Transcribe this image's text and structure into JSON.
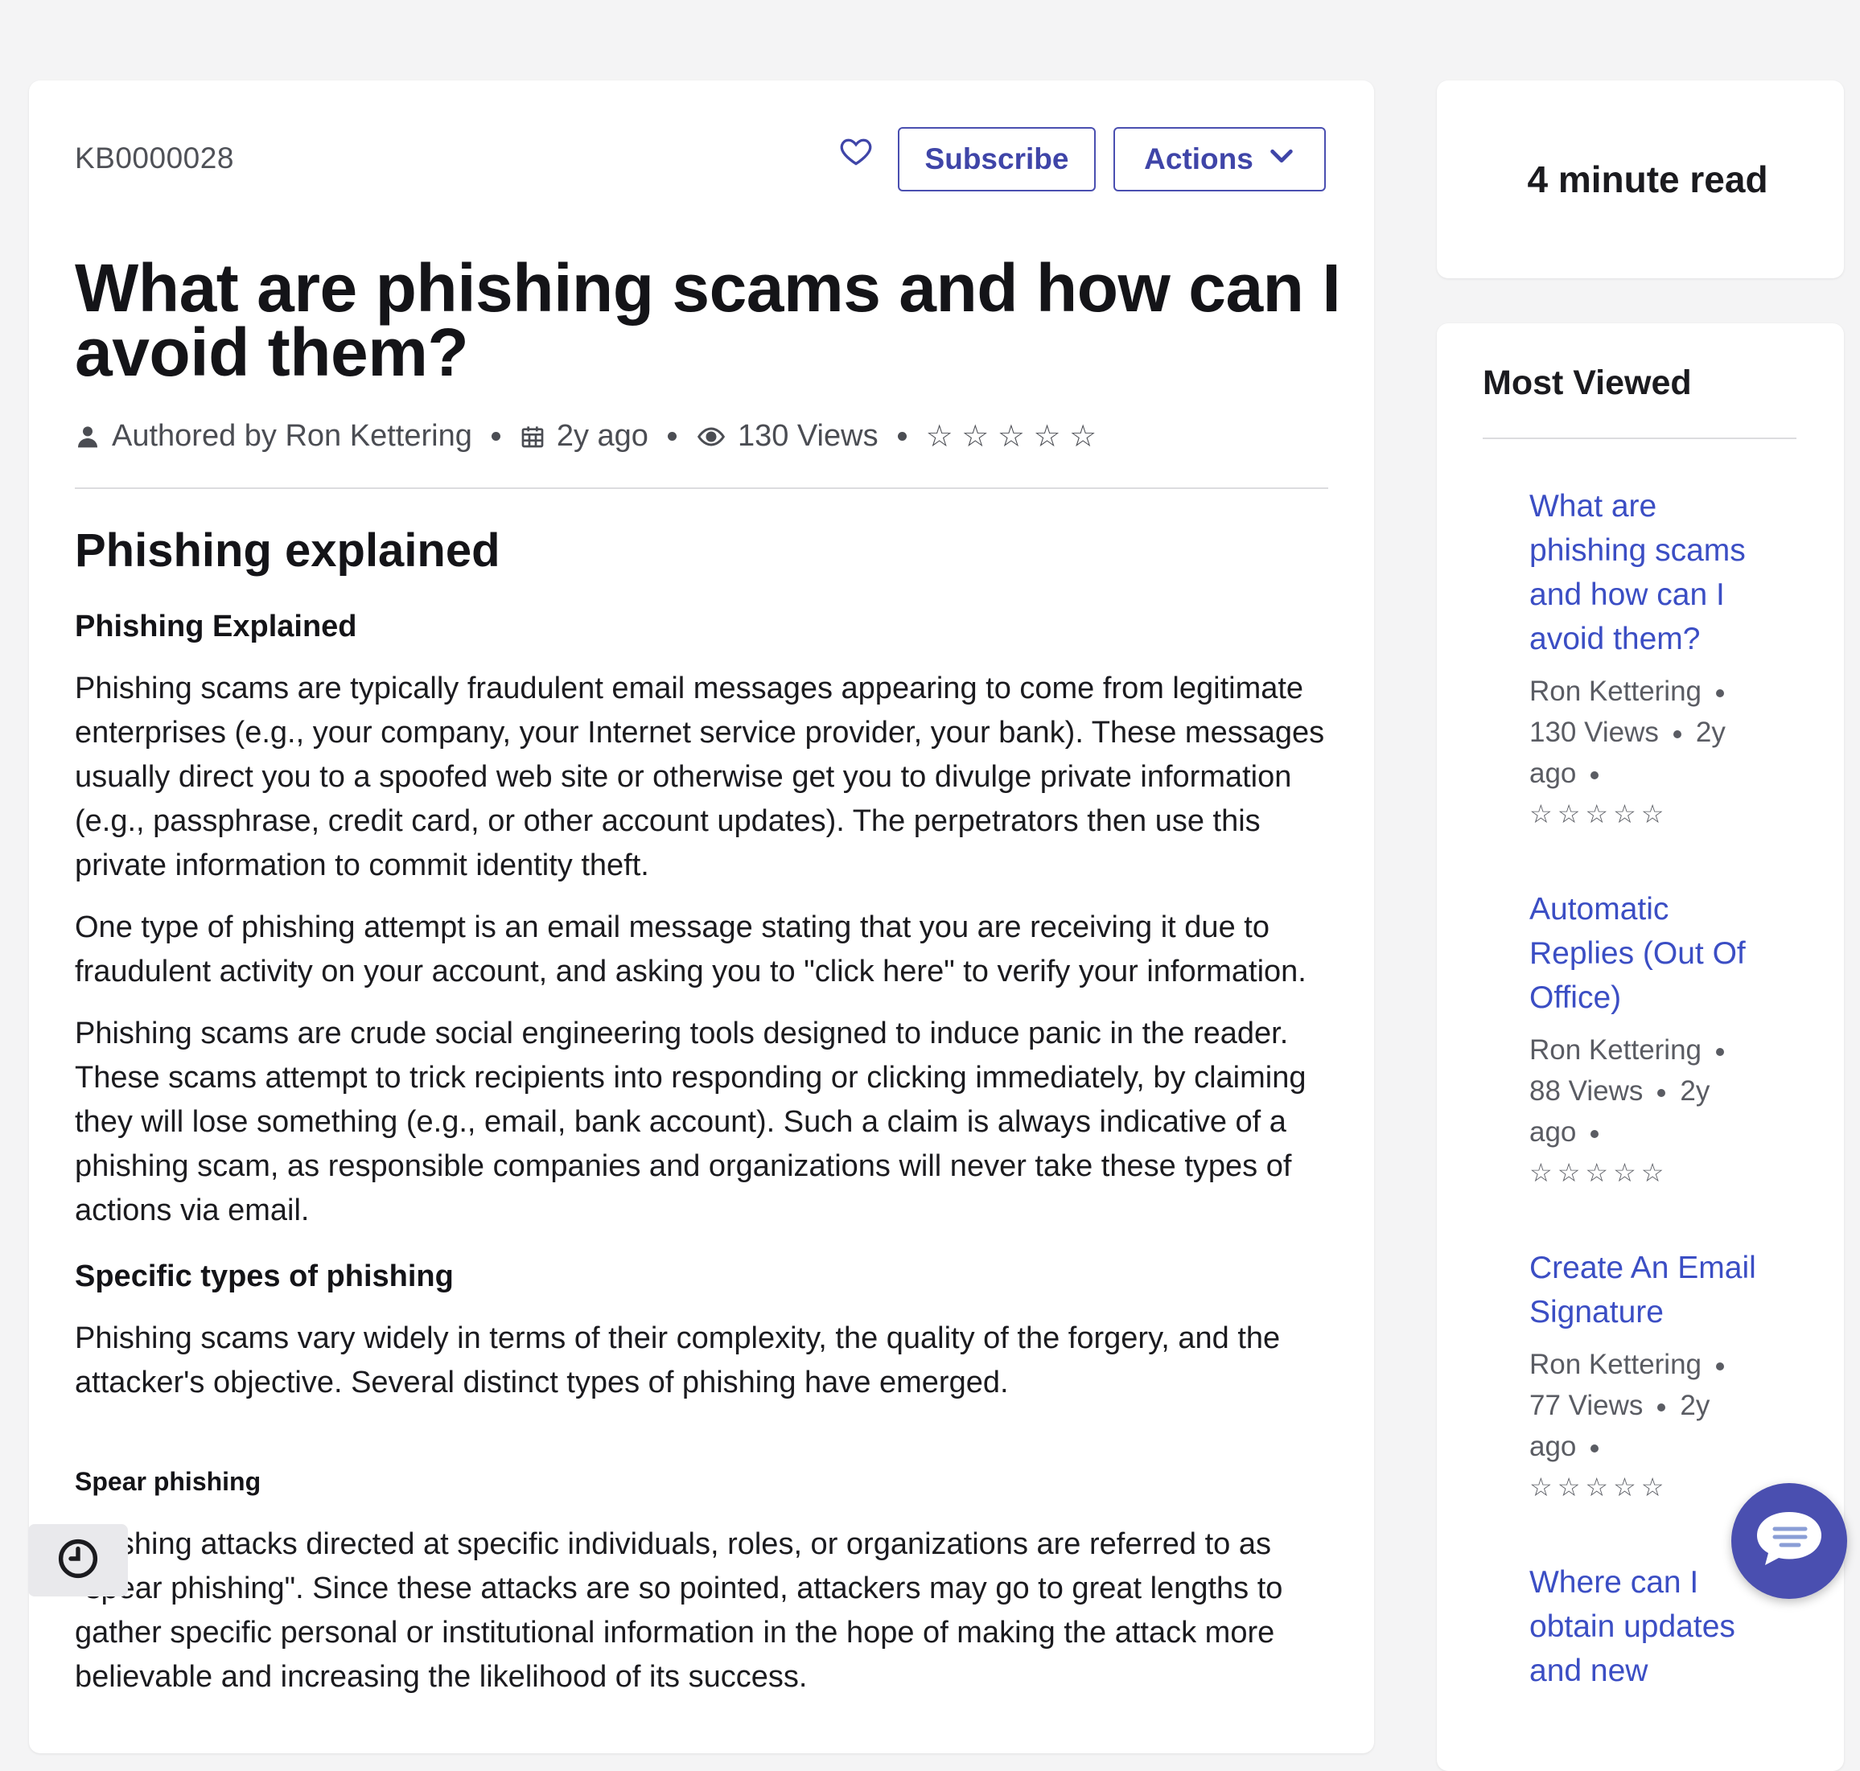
{
  "article": {
    "number": "KB0000028",
    "subscribe_label": "Subscribe",
    "actions_label": "Actions",
    "title": "What are phishing scams and how can I avoid them?",
    "meta": {
      "author": "Authored by Ron Kettering",
      "date": "2y ago",
      "views": "130 Views",
      "stars": "☆ ☆ ☆ ☆ ☆"
    },
    "heading": "Phishing explained",
    "sub1": "Phishing Explained",
    "p1": "Phishing scams are typically fraudulent email messages appearing to come from legitimate enterprises (e.g., your company, your Internet service provider, your bank). These messages usually direct you to a spoofed web site or otherwise get you to divulge private information (e.g., passphrase, credit card, or other account updates). The perpetrators then use this private information to commit identity theft.",
    "p2": "One type of phishing attempt is an email message stating that you are receiving it due to fraudulent activity on your account, and asking you to \"click here\" to verify your information.",
    "p3": "Phishing scams are crude social engineering tools designed to induce panic in the reader. These scams attempt to trick recipients into responding or clicking immediately, by claiming they will lose something (e.g., email, bank account). Such a claim is always indicative of a phishing scam, as responsible companies and organizations will never take these types of actions via email.",
    "sub2": "Specific types of phishing",
    "p4": "Phishing scams vary widely in terms of their complexity, the quality of the forgery, and the attacker's objective. Several distinct types of phishing have emerged.",
    "sub3": "Spear phishing",
    "p5": "Phishing attacks directed at specific individuals, roles, or organizations are referred to as \"spear phishing\". Since these attacks are so pointed, attackers may go to great lengths to gather specific personal or institutional information in the hope of making the attack more believable and increasing the likelihood of its success."
  },
  "read_time": "4 minute read",
  "most_viewed": {
    "title": "Most Viewed",
    "items": [
      {
        "title": "What are phishing scams and how can I avoid them?",
        "author": "Ron Kettering",
        "views": "130 Views",
        "date": "2y",
        "date2": "ago",
        "stars": "☆☆☆☆☆"
      },
      {
        "title": "Automatic Replies (Out Of Office)",
        "author": "Ron Kettering",
        "views": "88 Views",
        "date": "2y",
        "date2": "ago",
        "stars": "☆☆☆☆☆"
      },
      {
        "title": "Create An Email Signature",
        "author": "Ron Kettering",
        "views": "77 Views",
        "date": "2y",
        "date2": "ago",
        "stars": "☆☆☆☆☆"
      },
      {
        "title": "Where can I obtain updates and new",
        "author": "",
        "views": "",
        "date": "",
        "date2": "",
        "stars": ""
      }
    ]
  },
  "colors": {
    "accent": "#4a4fb0",
    "link": "#3b4ec4",
    "background": "#f4f4f5"
  },
  "icons": [
    "heart-icon",
    "chevron-down-icon",
    "user-icon",
    "calendar-icon",
    "eye-icon",
    "clock-icon",
    "chat-icon"
  ]
}
